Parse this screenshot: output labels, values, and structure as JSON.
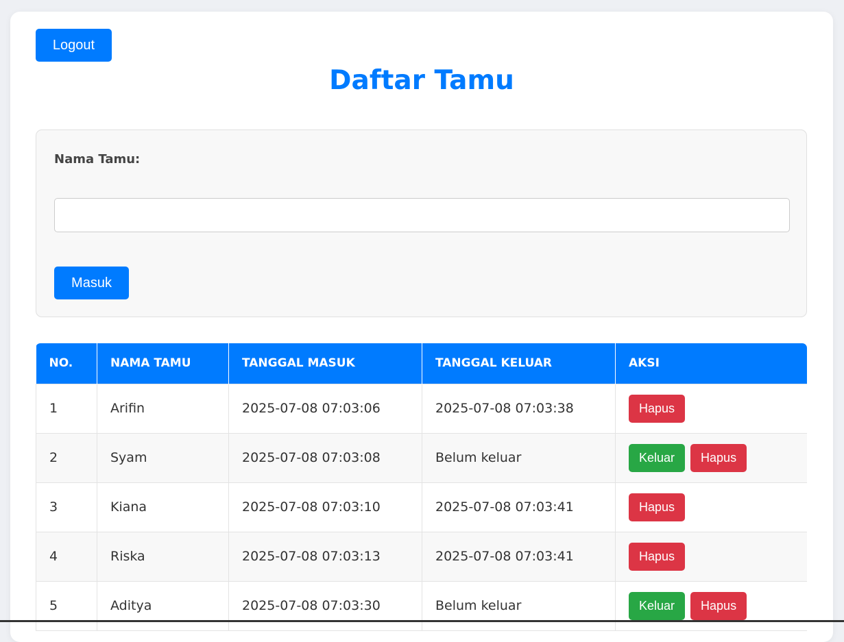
{
  "header": {
    "logout_label": "Logout",
    "title": "Daftar Tamu"
  },
  "form": {
    "label": "Nama Tamu:",
    "input_value": "",
    "submit_label": "Masuk"
  },
  "table": {
    "headers": [
      "NO.",
      "NAMA TAMU",
      "TANGGAL MASUK",
      "TANGGAL KELUAR",
      "AKSI"
    ],
    "rows": [
      {
        "no": "1",
        "name": "Arifin",
        "in": "2025-07-08 07:03:06",
        "out": "2025-07-08 07:03:38",
        "show_keluar": false
      },
      {
        "no": "2",
        "name": "Syam",
        "in": "2025-07-08 07:03:08",
        "out": "Belum keluar",
        "show_keluar": true
      },
      {
        "no": "3",
        "name": "Kiana",
        "in": "2025-07-08 07:03:10",
        "out": "2025-07-08 07:03:41",
        "show_keluar": false
      },
      {
        "no": "4",
        "name": "Riska",
        "in": "2025-07-08 07:03:13",
        "out": "2025-07-08 07:03:41",
        "show_keluar": false
      },
      {
        "no": "5",
        "name": "Aditya",
        "in": "2025-07-08 07:03:30",
        "out": "Belum keluar",
        "show_keluar": true
      }
    ],
    "keluar_label": "Keluar",
    "hapus_label": "Hapus"
  },
  "colors": {
    "primary": "#007bff",
    "success": "#28a745",
    "danger": "#dc3545"
  }
}
